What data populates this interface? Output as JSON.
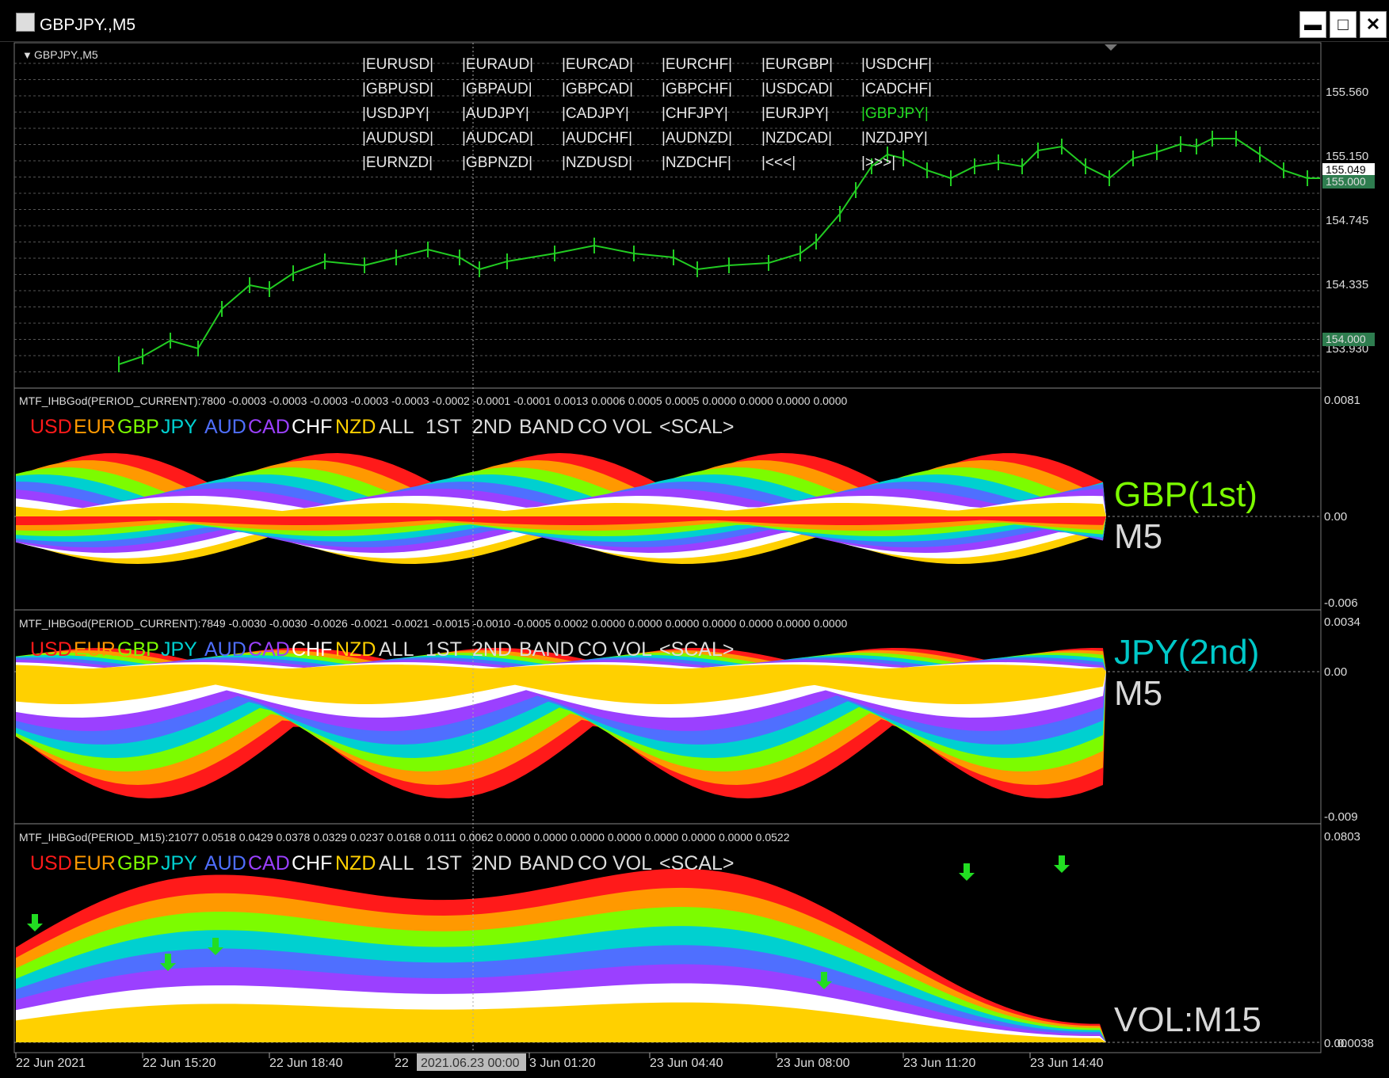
{
  "window": {
    "title": "GBPJPY.,M5",
    "buttons": {
      "minimize": "▬",
      "maximize": "□",
      "close": "✕"
    }
  },
  "chart_header": {
    "symbol_label": "GBPJPY.,M5"
  },
  "symbol_grid": [
    [
      "|EURUSD|",
      "|EURAUD|",
      "|EURCAD|",
      "|EURCHF|",
      "|EURGBP|",
      "|USDCHF|"
    ],
    [
      "|GBPUSD|",
      "|GBPAUD|",
      "|GBPCAD|",
      "|GBPCHF|",
      "|USDCAD|",
      "|CADCHF|"
    ],
    [
      "|USDJPY|",
      "|AUDJPY|",
      "|CADJPY|",
      "|CHFJPY|",
      "|EURJPY|",
      "|GBPJPY|"
    ],
    [
      "|AUDUSD|",
      "|AUDCAD|",
      "|AUDCHF|",
      "|AUDNZD|",
      "|NZDCAD|",
      "|NZDJPY|"
    ],
    [
      "|EURNZD|",
      "|GBPNZD|",
      "|NZDUSD|",
      "|NZDCHF|",
      "|<<<|",
      "|>>>|"
    ]
  ],
  "active_symbol": "|GBPJPY|",
  "price_axis": {
    "labels": [
      "155.560",
      "155.150",
      "154.745",
      "154.335",
      "153.930"
    ],
    "current_price": "155.049",
    "level_tags": [
      "155.000",
      "154.000"
    ]
  },
  "indicator_1": {
    "header": "MTF_IHBGod(PERIOD_CURRENT):7800 -0.0003 -0.0003 -0.0003 -0.0003 -0.0003 -0.0002 -0.0001 -0.0001 0.0013 0.0006 0.0005 0.0005 0.0000 0.0000 0.0000 0.0000",
    "top_label": "0.0081",
    "zero_label": "0.00",
    "bottom_label": "-0.006",
    "big_label": "GBP(1st)",
    "tf_label": "M5"
  },
  "indicator_2": {
    "header": "MTF_IHBGod(PERIOD_CURRENT):7849 -0.0030 -0.0030 -0.0026 -0.0021 -0.0021 -0.0015 -0.0010 -0.0005 0.0002 0.0000 0.0000 0.0000 0.0000 0.0000 0.0000 0.0000",
    "top_label": "0.0034",
    "zero_label": "0.00",
    "bottom_label": "-0.009",
    "big_label": "JPY(2nd)",
    "tf_label": "M5"
  },
  "indicator_3": {
    "header": "MTF_IHBGod(PERIOD_M15):21077 0.0518 0.0429 0.0378 0.0329 0.0237 0.0168 0.0111 0.0062 0.0000 0.0000 0.0000 0.0000 0.0000 0.0000 0.0000 0.0522",
    "top_label": "0.0803",
    "bottom_label": "0.0038",
    "zero_label": "0.00",
    "big_label": "VOL:M15"
  },
  "legend_items": [
    {
      "text": "USD",
      "color": "#ff1a1a"
    },
    {
      "text": "EUR",
      "color": "#ff9900"
    },
    {
      "text": "GBP",
      "color": "#7cfc00"
    },
    {
      "text": "JPY",
      "color": "#00d0d0"
    },
    {
      "text": "AUD",
      "color": "#4f6fff"
    },
    {
      "text": "CAD",
      "color": "#9b40ff"
    },
    {
      "text": "CHF",
      "color": "#ffffff"
    },
    {
      "text": "NZD",
      "color": "#ffd000"
    },
    {
      "text": "ALL",
      "color": "#dddddd"
    },
    {
      "text": "1ST",
      "color": "#dddddd"
    },
    {
      "text": "2ND",
      "color": "#dddddd"
    },
    {
      "text": "BAND",
      "color": "#dddddd"
    },
    {
      "text": "CO",
      "color": "#dddddd"
    },
    {
      "text": "VOL",
      "color": "#dddddd"
    },
    {
      "text": "<SCAL>",
      "color": "#dddddd"
    }
  ],
  "time_axis": [
    "22 Jun 2021",
    "22 Jun 15:20",
    "22 Jun 18:40",
    "22",
    "3 Jun 01:20",
    "23 Jun 04:40",
    "23 Jun 08:00",
    "23 Jun 11:20",
    "23 Jun 14:40"
  ],
  "crosshair_time": "2021.06.23 00:00",
  "colors": {
    "candle": "#22cc22",
    "gbp_label": "#7cfc00",
    "jpy_label": "#00c8c8",
    "white_label": "#d8d8d8",
    "arrow": "#22dd22",
    "price_tag_bg": "#2e7d4f"
  }
}
